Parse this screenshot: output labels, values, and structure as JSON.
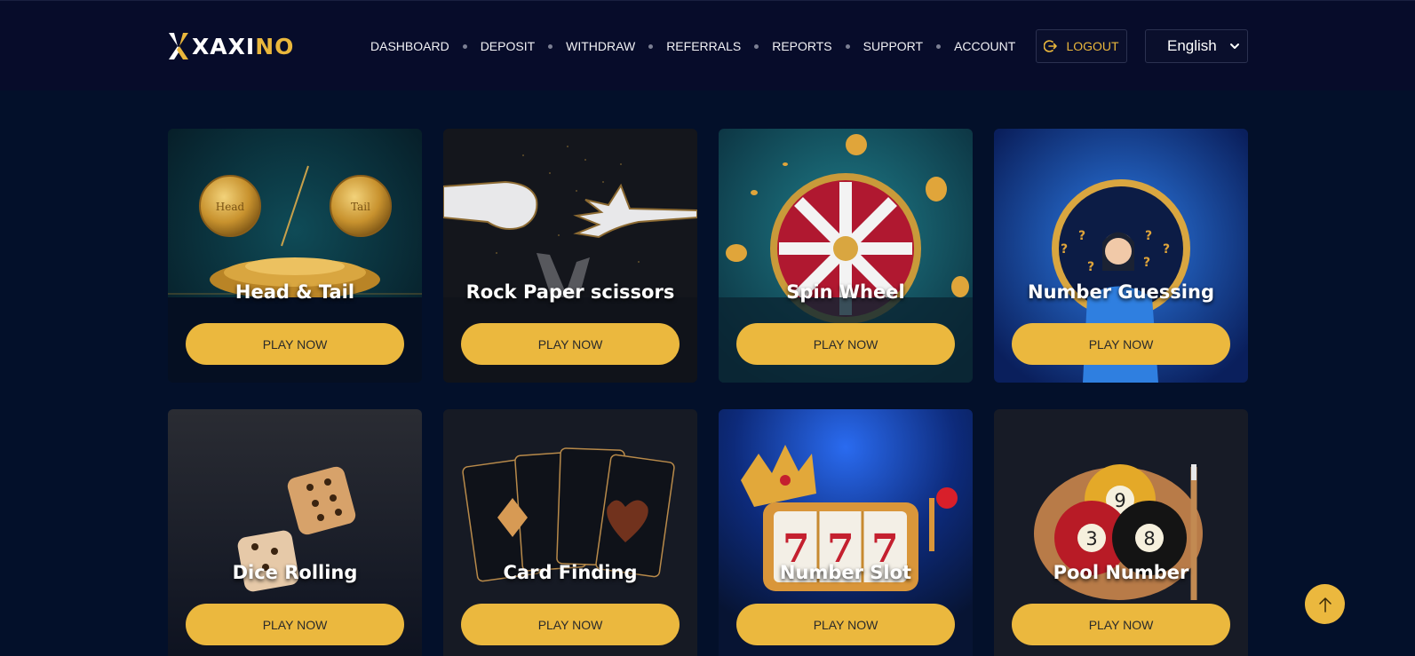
{
  "brand": {
    "logo_main": "XAXI",
    "logo_accent": "NO"
  },
  "nav": {
    "items": [
      {
        "label": "DASHBOARD"
      },
      {
        "label": "DEPOSIT"
      },
      {
        "label": "WITHDRAW"
      },
      {
        "label": "REFERRALS"
      },
      {
        "label": "REPORTS"
      },
      {
        "label": "SUPPORT"
      },
      {
        "label": "ACCOUNT"
      }
    ]
  },
  "header": {
    "logout_label": "LOGOUT",
    "language": "English"
  },
  "games": [
    {
      "title": "Head & Tail",
      "button": "PLAY NOW",
      "coin_head": "Head",
      "coin_tail": "Tail"
    },
    {
      "title": "Rock Paper scissors",
      "button": "PLAY NOW"
    },
    {
      "title": "Spin Wheel",
      "button": "PLAY NOW"
    },
    {
      "title": "Number Guessing",
      "button": "PLAY NOW"
    },
    {
      "title": "Dice Rolling",
      "button": "PLAY NOW"
    },
    {
      "title": "Card Finding",
      "button": "PLAY NOW"
    },
    {
      "title": "Number Slot",
      "button": "PLAY NOW"
    },
    {
      "title": "Pool Number",
      "button": "PLAY NOW",
      "balls": [
        "9",
        "3",
        "8"
      ]
    }
  ],
  "colors": {
    "accent": "#ebb83e",
    "background": "#03102a",
    "header_bg": "#070c2a"
  },
  "icons": {
    "logout": "logout-icon",
    "scroll_top": "arrow-up-icon",
    "select": "chevron-down-icon"
  }
}
